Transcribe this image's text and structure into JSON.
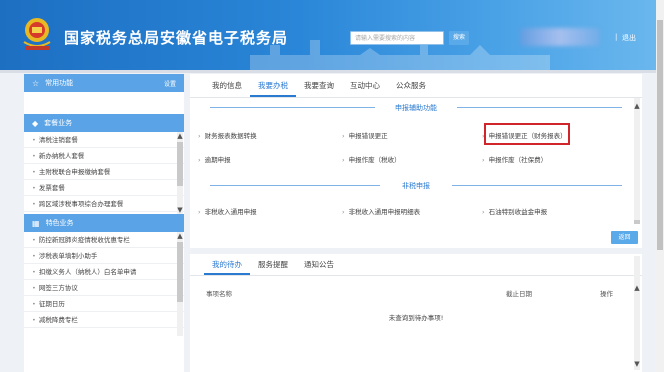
{
  "header": {
    "title": "国家税务总局安徽省电子税务局",
    "search_placeholder": "请输入需要搜索的内容",
    "search_button": "搜索",
    "separator": "|",
    "logout": "退出"
  },
  "sidebar": {
    "favorites": {
      "label": "常用功能",
      "action": "设置"
    },
    "package_section": "套餐业务",
    "package_items": [
      "清税注销套餐",
      "新办纳税人套餐",
      "主附税联合申报缴纳套餐",
      "发票套餐",
      "跨区域涉税事项综合办理套餐"
    ],
    "special_section": "特色业务",
    "special_items": [
      "防控新冠肺炎疫情税收优惠专栏",
      "涉税表单填制小助手",
      "扣缴义务人（纳税人）白名单申请",
      "网签三方协议",
      "征期日历",
      "减税降费专栏"
    ]
  },
  "main": {
    "tabs": [
      "我的信息",
      "我要办税",
      "我要查询",
      "互动中心",
      "公众服务"
    ],
    "section1_title": "申报辅助功能",
    "section1_links": [
      "财务报表数据转换",
      "申报错误更正",
      "申报错误更正（财务报表）",
      "逾期申报",
      "申报作废（税收）",
      "申报作废（社保费）"
    ],
    "section2_title": "非税申报",
    "section2_links": [
      "非税收入通用申报",
      "非税收入通用申报明细表",
      "石油特别收益金申报"
    ],
    "back_button": "返回"
  },
  "todo": {
    "tabs": [
      "我的待办",
      "服务提醒",
      "通知公告"
    ],
    "columns": [
      "事项名称",
      "截止日期",
      "操作"
    ],
    "empty_message": "未查询到待办事项!"
  },
  "colors": {
    "header_blue": "#2a86d8",
    "accent": "#2a7ad0",
    "highlight_red": "#d0252a"
  }
}
